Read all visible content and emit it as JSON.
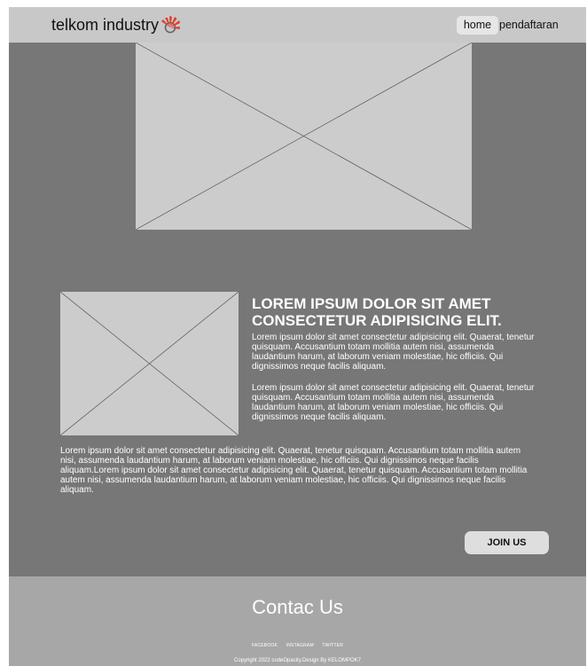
{
  "navbar": {
    "brand": "telkom industry",
    "logo_icon": "telkom-logo-icon",
    "links": [
      {
        "label": "home",
        "active": true
      },
      {
        "label": "pendaftaran",
        "active": false
      }
    ]
  },
  "content": {
    "title": "LOREM IPSUM DOLOR SIT AMET CONSECTETUR ADIPISICING ELIT.",
    "paragraphs": [
      "Lorem ipsum dolor sit amet consectetur adipisicing elit. Quaerat, tenetur quisquam. Accusantium totam mollitia autem nisi, assumenda laudantium harum, at laborum veniam molestiae, hic officiis. Qui dignissimos neque facilis aliquam.",
      "Lorem ipsum dolor sit amet consectetur adipisicing elit. Quaerat, tenetur quisquam. Accusantium totam mollitia autem nisi, assumenda laudantium harum, at laborum veniam molestiae, hic officiis. Qui dignissimos neque facilis aliquam.",
      "Lorem ipsum dolor sit amet consectetur adipisicing elit. Quaerat, tenetur quisquam. Accusantium totam mollitia autem nisi, assumenda laudantium harum, at laborum veniam molestiae, hic officiis. Qui dignissimos neque facilis aliquam.Lorem ipsum dolor sit amet consectetur adipisicing elit. Quaerat, tenetur quisquam. Accusantium totam mollitia autem nisi, assumenda laudantium harum, at laborum veniam molestiae, hic officiis. Qui dignissimos neque facilis aliquam."
    ],
    "join_label": "JOIN US"
  },
  "footer": {
    "title": "Contac Us",
    "socials": [
      "FACEBOOK",
      "INSTAGRAM",
      "TWITTER"
    ],
    "copyright": "Copyright 2022 codeOpacity.Design By KELOMPOK7"
  },
  "colors": {
    "page_bg": "#777777",
    "navbar_bg": "#c8c8c8",
    "footer_bg": "#a7a7a7",
    "placeholder": "#cccccc",
    "logo_red": "#e03a2e"
  }
}
